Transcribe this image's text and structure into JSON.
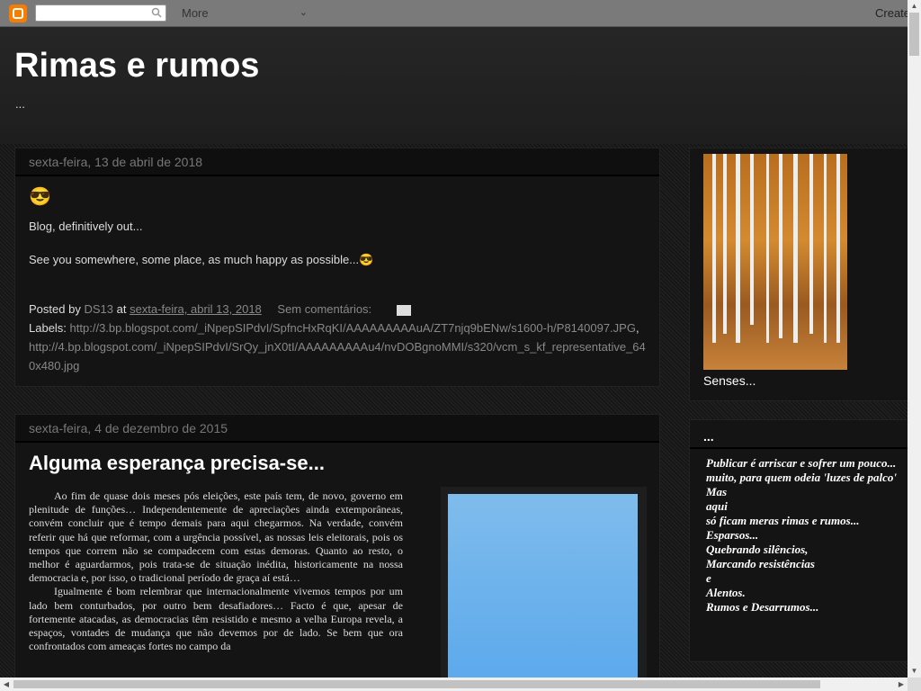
{
  "navbar": {
    "more_label": "More",
    "create_label": "Create"
  },
  "header": {
    "title": "Rimas e rumos",
    "description": "..."
  },
  "posts": [
    {
      "date": "sexta-feira, 13 de abril de 2018",
      "emoji": "😎",
      "paragraphs": [
        "Blog, definitively out...",
        "See you somewhere, some place, as much happy as possible...😎"
      ],
      "posted_by_label": "Posted by",
      "author": "DS13",
      "at_label": "at",
      "timestamp": "sexta-feira, abril 13, 2018",
      "comments": "Sem comentários:",
      "labels_label": "Labels:",
      "label_1": "http://3.bp.blogspot.com/_iNpepSIPdvI/SpfncHxRqKI/AAAAAAAAAuA/ZT7njq9bENw/s1600-h/P8140097.JPG",
      "label_2": "http://4.bp.blogspot.com/_iNpepSIPdvI/SrQy_jnX0tI/AAAAAAAAAu4/nvDOBgnoMMI/s320/vcm_s_kf_representative_640x480.jpg"
    },
    {
      "date": "sexta-feira, 4 de dezembro de 2015",
      "title": "Alguma esperança precisa-se...",
      "paragraphs": [
        "Ao fim de quase dois meses pós eleições, este país tem, de novo, governo em plenitude de funções… Independentemente de apreciações ainda extemporâneas, convém concluir que é tempo demais para aqui chegarmos. Na verdade, convém referir que há que reformar, com a urgência possível, as nossas leis eleitorais, pois os tempos que correm não se compadecem com estas demoras. Quanto ao resto, o melhor é aguardarmos, pois trata-se de situação inédita, historicamente na nossa democracia e, por isso, o tradicional período de graça aí está…",
        "Igualmente é bom relembrar que internacionalmente vivemos tempos por um lado bem conturbados, por outro bem desafiadores… Facto é que, apesar de fortemente atacadas, as democracias têm resistido e mesmo a velha Europa revela, a espaços, vontades de mudança que não devemos por de lado. Se bem que ora confrontados com ameaças fortes no campo da"
      ]
    }
  ],
  "sidebar": {
    "image_caption": "Senses...",
    "poem_heading": "...",
    "poem_lines": [
      "Publicar é arriscar e sofrer um pouco...",
      "muito, para quem odeia 'luzes de palco'",
      "Mas",
      "aqui",
      "só ficam meras rimas e rumos...",
      "Esparsos...",
      "Quebrando silêncios,",
      "Marcando resistências",
      "e",
      "Alentos.",
      "Rumos e Desarrumos..."
    ]
  },
  "colors": {
    "navbar": "#7a7a7a",
    "blogger_orange": "#f57d00",
    "link": "#888888"
  }
}
